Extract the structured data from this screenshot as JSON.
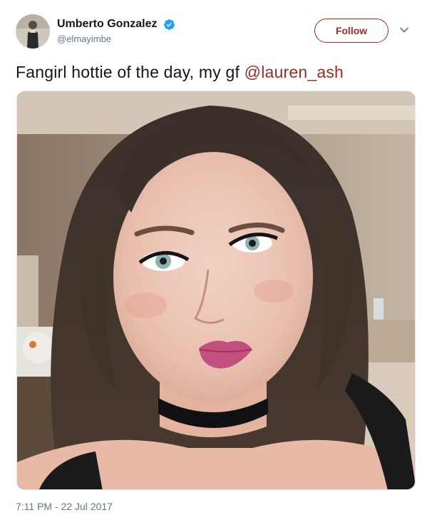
{
  "author": {
    "display_name": "Umberto Gonzalez",
    "handle": "@elmayimbe",
    "verified": true
  },
  "actions": {
    "follow_label": "Follow"
  },
  "tweet": {
    "text": "Fangirl hottie of the day, my gf ",
    "mention": "@lauren_ash",
    "timestamp": "7:11 PM - 22 Jul 2017"
  },
  "colors": {
    "accent": "#9e2b25",
    "verified_blue": "#1da1f2",
    "secondary_text": "#657786",
    "primary_text": "#14171a"
  },
  "icons": {
    "verified": "verified-badge-icon",
    "caret": "chevron-down-icon"
  }
}
